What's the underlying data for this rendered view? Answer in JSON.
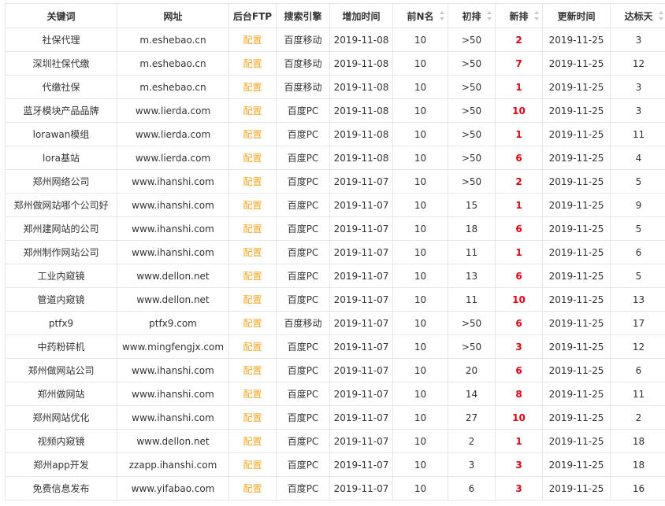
{
  "table": {
    "headers": [
      {
        "key": "keyword",
        "label": "关键词",
        "sortable": false
      },
      {
        "key": "url",
        "label": "网址",
        "sortable": false
      },
      {
        "key": "ftp",
        "label": "后台FTP",
        "sortable": false
      },
      {
        "key": "engine",
        "label": "搜索引擎",
        "sortable": false
      },
      {
        "key": "added",
        "label": "增加时间",
        "sortable": false
      },
      {
        "key": "top_n",
        "label": "前N名",
        "sortable": true
      },
      {
        "key": "initial_rank",
        "label": "初排",
        "sortable": true
      },
      {
        "key": "new_rank",
        "label": "新排",
        "sortable": true
      },
      {
        "key": "updated",
        "label": "更新时间",
        "sortable": false
      },
      {
        "key": "days_reached",
        "label": "达标天",
        "sortable": true
      }
    ],
    "rows": [
      {
        "keyword": "社保代理",
        "url": "m.eshebao.cn",
        "ftp": "配置",
        "engine": "百度移动",
        "added": "2019-11-08",
        "top_n": "10",
        "initial_rank": ">50",
        "new_rank": "2",
        "updated": "2019-11-25",
        "days_reached": "3"
      },
      {
        "keyword": "深圳社保代缴",
        "url": "m.eshebao.cn",
        "ftp": "配置",
        "engine": "百度移动",
        "added": "2019-11-08",
        "top_n": "10",
        "initial_rank": ">50",
        "new_rank": "7",
        "updated": "2019-11-25",
        "days_reached": "12"
      },
      {
        "keyword": "代缴社保",
        "url": "m.eshebao.cn",
        "ftp": "配置",
        "engine": "百度移动",
        "added": "2019-11-08",
        "top_n": "10",
        "initial_rank": ">50",
        "new_rank": "1",
        "updated": "2019-11-25",
        "days_reached": "3"
      },
      {
        "keyword": "蓝牙模块产品品牌",
        "url": "www.lierda.com",
        "ftp": "配置",
        "engine": "百度PC",
        "added": "2019-11-08",
        "top_n": "10",
        "initial_rank": ">50",
        "new_rank": "10",
        "updated": "2019-11-25",
        "days_reached": "3"
      },
      {
        "keyword": "lorawan模组",
        "url": "www.lierda.com",
        "ftp": "配置",
        "engine": "百度PC",
        "added": "2019-11-08",
        "top_n": "10",
        "initial_rank": ">50",
        "new_rank": "1",
        "updated": "2019-11-25",
        "days_reached": "11"
      },
      {
        "keyword": "lora基站",
        "url": "www.lierda.com",
        "ftp": "配置",
        "engine": "百度PC",
        "added": "2019-11-08",
        "top_n": "10",
        "initial_rank": ">50",
        "new_rank": "6",
        "updated": "2019-11-25",
        "days_reached": "4"
      },
      {
        "keyword": "郑州网络公司",
        "url": "www.ihanshi.com",
        "ftp": "配置",
        "engine": "百度PC",
        "added": "2019-11-07",
        "top_n": "10",
        "initial_rank": ">50",
        "new_rank": "2",
        "updated": "2019-11-25",
        "days_reached": "5"
      },
      {
        "keyword": "郑州做网站哪个公司好",
        "url": "www.ihanshi.com",
        "ftp": "配置",
        "engine": "百度PC",
        "added": "2019-11-07",
        "top_n": "10",
        "initial_rank": "15",
        "new_rank": "1",
        "updated": "2019-11-25",
        "days_reached": "9"
      },
      {
        "keyword": "郑州建网站的公司",
        "url": "www.ihanshi.com",
        "ftp": "配置",
        "engine": "百度PC",
        "added": "2019-11-07",
        "top_n": "10",
        "initial_rank": "18",
        "new_rank": "6",
        "updated": "2019-11-25",
        "days_reached": "5"
      },
      {
        "keyword": "郑州制作网站公司",
        "url": "www.ihanshi.com",
        "ftp": "配置",
        "engine": "百度PC",
        "added": "2019-11-07",
        "top_n": "10",
        "initial_rank": "11",
        "new_rank": "1",
        "updated": "2019-11-25",
        "days_reached": "6"
      },
      {
        "keyword": "工业内窥镜",
        "url": "www.dellon.net",
        "ftp": "配置",
        "engine": "百度PC",
        "added": "2019-11-07",
        "top_n": "10",
        "initial_rank": "13",
        "new_rank": "6",
        "updated": "2019-11-25",
        "days_reached": "5"
      },
      {
        "keyword": "管道内窥镜",
        "url": "www.dellon.net",
        "ftp": "配置",
        "engine": "百度PC",
        "added": "2019-11-07",
        "top_n": "10",
        "initial_rank": "11",
        "new_rank": "10",
        "updated": "2019-11-25",
        "days_reached": "13"
      },
      {
        "keyword": "ptfx9",
        "url": "ptfx9.com",
        "ftp": "配置",
        "engine": "百度移动",
        "added": "2019-11-07",
        "top_n": "10",
        "initial_rank": ">50",
        "new_rank": "6",
        "updated": "2019-11-25",
        "days_reached": "17"
      },
      {
        "keyword": "中药粉碎机",
        "url": "www.mingfengjx.com",
        "ftp": "配置",
        "engine": "百度PC",
        "added": "2019-11-07",
        "top_n": "10",
        "initial_rank": ">50",
        "new_rank": "3",
        "updated": "2019-11-25",
        "days_reached": "12"
      },
      {
        "keyword": "郑州做网站公司",
        "url": "www.ihanshi.com",
        "ftp": "配置",
        "engine": "百度PC",
        "added": "2019-11-07",
        "top_n": "10",
        "initial_rank": "20",
        "new_rank": "6",
        "updated": "2019-11-25",
        "days_reached": "6"
      },
      {
        "keyword": "郑州做网站",
        "url": "www.ihanshi.com",
        "ftp": "配置",
        "engine": "百度PC",
        "added": "2019-11-07",
        "top_n": "10",
        "initial_rank": "14",
        "new_rank": "8",
        "updated": "2019-11-25",
        "days_reached": "11"
      },
      {
        "keyword": "郑州网站优化",
        "url": "www.ihanshi.com",
        "ftp": "配置",
        "engine": "百度PC",
        "added": "2019-11-07",
        "top_n": "10",
        "initial_rank": "27",
        "new_rank": "10",
        "updated": "2019-11-25",
        "days_reached": "2"
      },
      {
        "keyword": "视频内窥镜",
        "url": "www.dellon.net",
        "ftp": "配置",
        "engine": "百度PC",
        "added": "2019-11-07",
        "top_n": "10",
        "initial_rank": "2",
        "new_rank": "1",
        "updated": "2019-11-25",
        "days_reached": "18"
      },
      {
        "keyword": "郑州app开发",
        "url": "zzapp.ihanshi.com",
        "ftp": "配置",
        "engine": "百度PC",
        "added": "2019-11-07",
        "top_n": "10",
        "initial_rank": "3",
        "new_rank": "3",
        "updated": "2019-11-25",
        "days_reached": "18"
      },
      {
        "keyword": "免费信息发布",
        "url": "www.yifabao.com",
        "ftp": "配置",
        "engine": "百度PC",
        "added": "2019-11-07",
        "top_n": "10",
        "initial_rank": "6",
        "new_rank": "3",
        "updated": "2019-11-25",
        "days_reached": "16"
      }
    ]
  },
  "colors": {
    "config_link": "#f5a623",
    "new_rank": "#e60012",
    "border": "#e6e6e6",
    "sort_arrow": "#c7c7c7"
  },
  "icons": {
    "sort": "sort-arrows-icon"
  }
}
